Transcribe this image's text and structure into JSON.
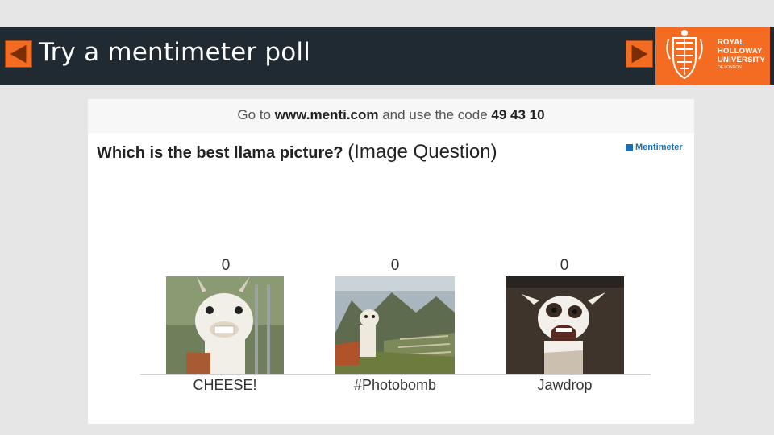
{
  "slide": {
    "title": "Try a mentimeter poll",
    "prev_icon": "triangle-left-icon",
    "next_icon": "triangle-right-icon",
    "accent_color": "#f36c21",
    "bar_color": "#1f2a33"
  },
  "logo": {
    "line1": "ROYAL",
    "line2": "HOLLOWAY",
    "line3": "UNIVERSITY",
    "line4": "OF LONDON",
    "crest_icon": "crest-icon"
  },
  "poll": {
    "instruction_prefix": "Go to ",
    "url": "www.menti.com",
    "instruction_middle": " and use the code ",
    "code": "49 43 10",
    "question": "Which is the best llama picture?",
    "question_type": "(Image Question)",
    "brand": "Mentimeter",
    "brand_color": "#1c6fb5",
    "options": [
      {
        "label": "CHEESE!",
        "count": "0"
      },
      {
        "label": "#Photobomb",
        "count": "0"
      },
      {
        "label": "Jawdrop",
        "count": "0"
      }
    ]
  }
}
